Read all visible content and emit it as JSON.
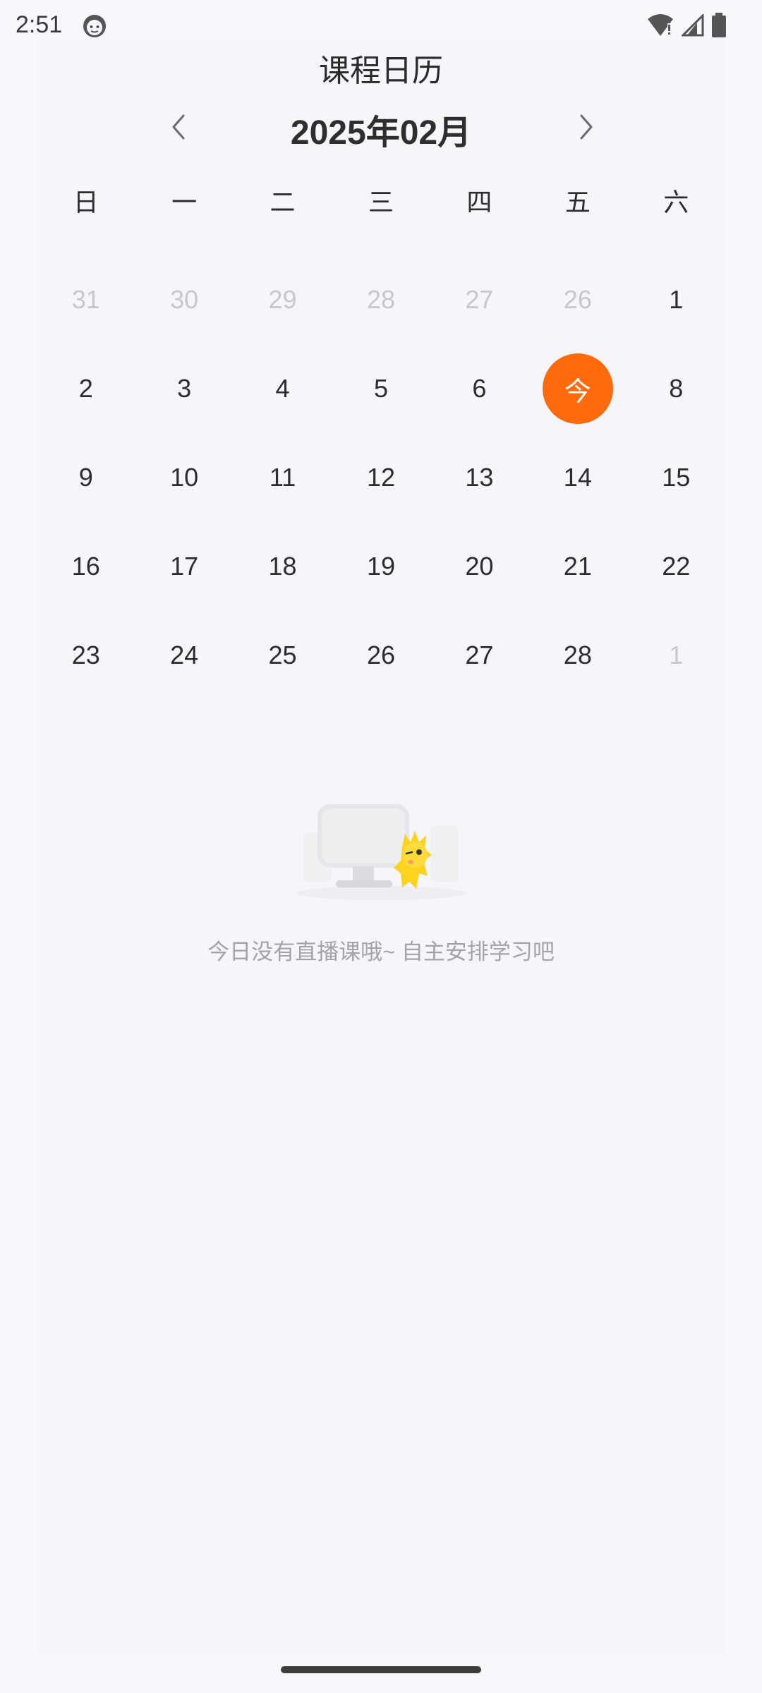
{
  "status_bar": {
    "time": "2:51",
    "icons": [
      "app-notification-icon",
      "wifi-icon",
      "signal-icon",
      "battery-icon"
    ]
  },
  "page": {
    "title": "课程日历"
  },
  "calendar": {
    "month_label": "2025年02月",
    "weekdays": [
      "日",
      "一",
      "二",
      "三",
      "四",
      "五",
      "六"
    ],
    "weeks": [
      [
        {
          "label": "31",
          "other": true
        },
        {
          "label": "30",
          "other": true
        },
        {
          "label": "29",
          "other": true
        },
        {
          "label": "28",
          "other": true
        },
        {
          "label": "27",
          "other": true
        },
        {
          "label": "26",
          "other": true
        },
        {
          "label": "1",
          "other": false
        }
      ],
      [
        {
          "label": "2",
          "other": false
        },
        {
          "label": "3",
          "other": false
        },
        {
          "label": "4",
          "other": false
        },
        {
          "label": "5",
          "other": false
        },
        {
          "label": "6",
          "other": false
        },
        {
          "label": "今",
          "other": false,
          "today": true
        },
        {
          "label": "8",
          "other": false
        }
      ],
      [
        {
          "label": "9",
          "other": false
        },
        {
          "label": "10",
          "other": false
        },
        {
          "label": "11",
          "other": false
        },
        {
          "label": "12",
          "other": false
        },
        {
          "label": "13",
          "other": false
        },
        {
          "label": "14",
          "other": false
        },
        {
          "label": "15",
          "other": false
        }
      ],
      [
        {
          "label": "16",
          "other": false
        },
        {
          "label": "17",
          "other": false
        },
        {
          "label": "18",
          "other": false
        },
        {
          "label": "19",
          "other": false
        },
        {
          "label": "20",
          "other": false
        },
        {
          "label": "21",
          "other": false
        },
        {
          "label": "22",
          "other": false
        }
      ],
      [
        {
          "label": "23",
          "other": false
        },
        {
          "label": "24",
          "other": false
        },
        {
          "label": "25",
          "other": false
        },
        {
          "label": "26",
          "other": false
        },
        {
          "label": "27",
          "other": false
        },
        {
          "label": "28",
          "other": false
        },
        {
          "label": "1",
          "other": true
        }
      ]
    ],
    "today_color": "#ff6a0c"
  },
  "empty_state": {
    "message": "今日没有直播课哦~ 自主安排学习吧"
  }
}
